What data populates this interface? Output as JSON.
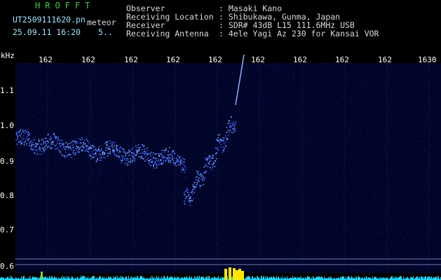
{
  "header": {
    "brand": "HROFFT",
    "filename": "UT2509111620.pn",
    "tag": "meteor",
    "datetime": "25.09.11 16:20",
    "count": "5..",
    "info_labels": [
      "Observer",
      "Receiving Location",
      "Receiver",
      "Receiving Antenna"
    ],
    "info_values": [
      ": Masaki Kano",
      ": Shibukawa, Gunma, Japan",
      ": SDR# 43dB L15 111.6MHz USB",
      ": 4ele Yagi Az 230 for Kansai VOR"
    ]
  },
  "axis": {
    "unit": "kHz",
    "y_ticks": [
      "1.1",
      "1.0",
      "0.9",
      "0.8",
      "0.7",
      "0.6"
    ],
    "x_ticks": [
      "162",
      "162",
      "162",
      "162",
      "162",
      "162",
      "162",
      "162",
      "162",
      "1630"
    ]
  },
  "colors": {
    "background": "#000000",
    "signal": "#3b63ff",
    "header_cyan": "#9fe4ff",
    "brand_green": "#3bd13b",
    "burst": "#ffe600"
  }
}
